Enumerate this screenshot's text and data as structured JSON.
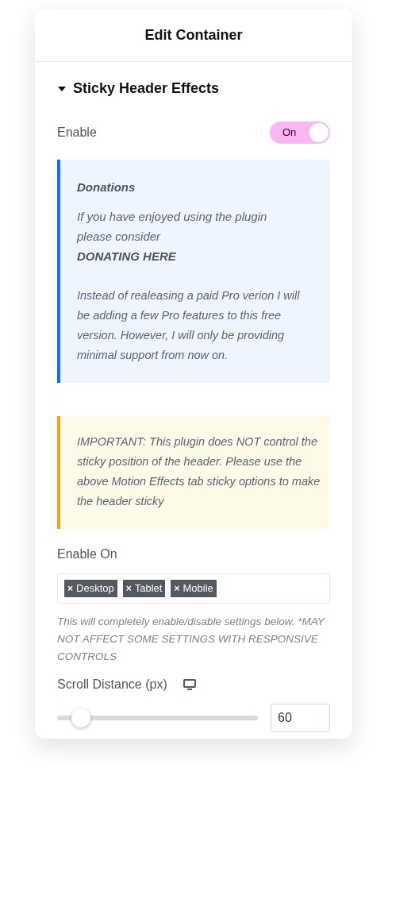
{
  "panel": {
    "title": "Edit Container"
  },
  "section": {
    "title": "Sticky Header Effects",
    "expanded": true
  },
  "enable": {
    "label": "Enable",
    "on": true,
    "state_text": "On"
  },
  "donation_notice": {
    "title": "Donations",
    "lines": [
      "If you have enjoyed using the plugin",
      "please consider"
    ],
    "link": "DONATING HERE",
    "body": "Instead of realeasing a paid Pro verion I will be adding a few Pro features to this free version. However, I will only be providing minimal support from now on."
  },
  "important_notice": {
    "text": "IMPORTANT: This plugin does NOT control the sticky position of the header. Please use the above Motion Effects tab sticky options to make the header sticky"
  },
  "enable_on": {
    "label": "Enable On",
    "tags": [
      {
        "remove": "×",
        "label": "Desktop"
      },
      {
        "remove": "×",
        "label": "Tablet"
      },
      {
        "remove": "×",
        "label": "Mobile"
      }
    ],
    "help": "This will completely enable/disable settings below. *MAY NOT AFFECT SOME SETTINGS WITH RESPONSIVE CONTROLS"
  },
  "scroll_distance": {
    "label": "Scroll Distance (px)",
    "level": 0.12,
    "value": "60"
  }
}
